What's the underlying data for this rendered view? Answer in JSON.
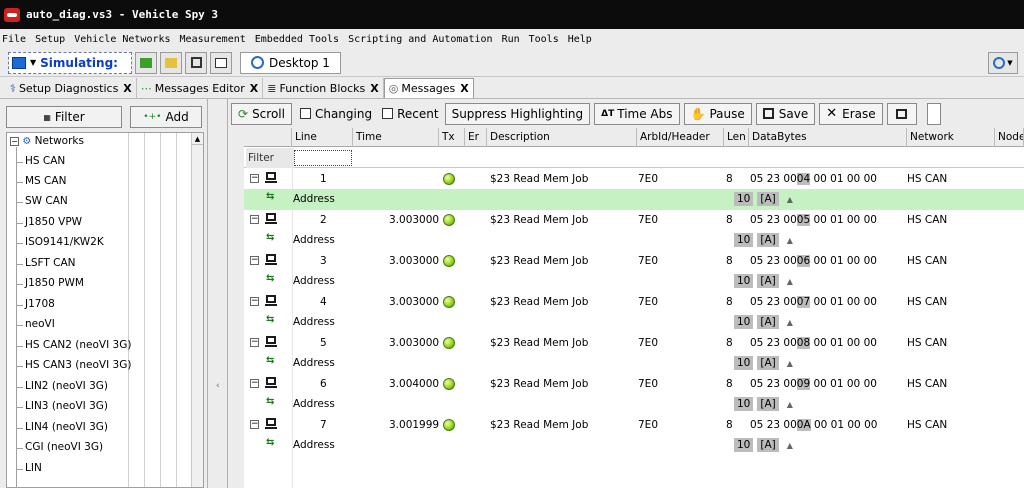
{
  "window": {
    "title": "auto_diag.vs3 - Vehicle Spy 3"
  },
  "menu": [
    "File",
    "Setup",
    "Vehicle Networks",
    "Measurement",
    "Embedded Tools",
    "Scripting and Automation",
    "Run",
    "Tools",
    "Help"
  ],
  "toolbar": {
    "mode": "Simulating:",
    "desktop_tab": "Desktop 1"
  },
  "tabs": [
    {
      "label": "Setup Diagnostics",
      "close": "X"
    },
    {
      "label": "Messages Editor",
      "close": "X"
    },
    {
      "label": "Function Blocks",
      "close": "X"
    },
    {
      "label": "Messages",
      "close": "X"
    }
  ],
  "left_panel": {
    "filter_button": "Filter",
    "add_button": "Add",
    "tree_root": "Networks",
    "items": [
      "HS CAN",
      "MS CAN",
      "SW CAN",
      "J1850 VPW",
      "ISO9141/KW2K",
      "LSFT CAN",
      "J1850 PWM",
      "J1708",
      "neoVI",
      "HS CAN2 (neoVI 3G)",
      "HS CAN3 (neoVI 3G)",
      "LIN2 (neoVI 3G)",
      "LIN3 (neoVI 3G)",
      "LIN4 (neoVI 3G)",
      "CGI (neoVI 3G)",
      "LIN"
    ]
  },
  "messages_toolbar": {
    "scroll": "Scroll",
    "changing": "Changing",
    "recent": "Recent",
    "suppress": "Suppress Highlighting",
    "time_abs": "Time Abs",
    "pause": "Pause",
    "save": "Save",
    "erase": "Erase"
  },
  "columns": [
    "Line",
    "Time",
    "Tx",
    "Er",
    "Description",
    "ArbId/Header",
    "Len",
    "DataBytes",
    "Network",
    "Node"
  ],
  "filter_label": "Filter",
  "rows": [
    {
      "line": "1",
      "time": "",
      "description": "$23 Read Mem Job",
      "arbid": "7E0",
      "len": "8",
      "data_pre": "05 23 00",
      "data_hl": "04",
      "data_post": "00 01 00 00",
      "network": "HS CAN",
      "signal": "Address",
      "sig_val": "10",
      "sig_tag": "[A]",
      "sig_arrow": "▲"
    },
    {
      "line": "2",
      "time": "3.003000 s",
      "description": "$23 Read Mem Job",
      "arbid": "7E0",
      "len": "8",
      "data_pre": "05 23 00",
      "data_hl": "05",
      "data_post": "00 01 00 00",
      "network": "HS CAN",
      "signal": "Address",
      "sig_val": "10",
      "sig_tag": "[A]",
      "sig_arrow": "▲"
    },
    {
      "line": "3",
      "time": "3.003000 s",
      "description": "$23 Read Mem Job",
      "arbid": "7E0",
      "len": "8",
      "data_pre": "05 23 00",
      "data_hl": "06",
      "data_post": "00 01 00 00",
      "network": "HS CAN",
      "signal": "Address",
      "sig_val": "10",
      "sig_tag": "[A]",
      "sig_arrow": "▲"
    },
    {
      "line": "4",
      "time": "3.003000 s",
      "description": "$23 Read Mem Job",
      "arbid": "7E0",
      "len": "8",
      "data_pre": "05 23 00",
      "data_hl": "07",
      "data_post": "00 01 00 00",
      "network": "HS CAN",
      "signal": "Address",
      "sig_val": "10",
      "sig_tag": "[A]",
      "sig_arrow": "▲"
    },
    {
      "line": "5",
      "time": "3.003000 s",
      "description": "$23 Read Mem Job",
      "arbid": "7E0",
      "len": "8",
      "data_pre": "05 23 00",
      "data_hl": "08",
      "data_post": "00 01 00 00",
      "network": "HS CAN",
      "signal": "Address",
      "sig_val": "10",
      "sig_tag": "[A]",
      "sig_arrow": "▲"
    },
    {
      "line": "6",
      "time": "3.004000 s",
      "description": "$23 Read Mem Job",
      "arbid": "7E0",
      "len": "8",
      "data_pre": "05 23 00",
      "data_hl": "09",
      "data_post": "00 01 00 00",
      "network": "HS CAN",
      "signal": "Address",
      "sig_val": "10",
      "sig_tag": "[A]",
      "sig_arrow": "▲"
    },
    {
      "line": "7",
      "time": "3.001999 s",
      "description": "$23 Read Mem Job",
      "arbid": "7E0",
      "len": "8",
      "data_pre": "05 23 00",
      "data_hl": "0A",
      "data_post": "00 01 00 00",
      "network": "HS CAN",
      "signal": "Address",
      "sig_val": "10",
      "sig_tag": "[A]",
      "sig_arrow": "▲"
    }
  ]
}
